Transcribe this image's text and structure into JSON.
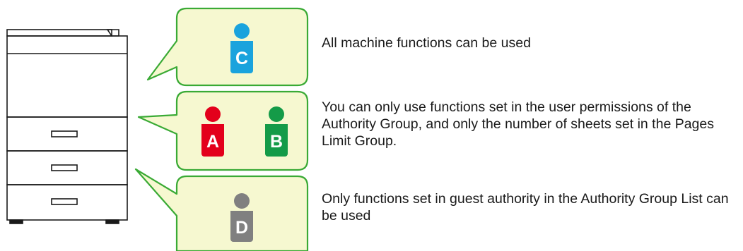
{
  "users": {
    "c": {
      "letter": "C",
      "color": "#1aa3dd"
    },
    "a": {
      "letter": "A",
      "color": "#e3001b"
    },
    "b": {
      "letter": "B",
      "color": "#149b48"
    },
    "d": {
      "letter": "D",
      "color": "#808080"
    }
  },
  "descriptions": {
    "c": "All machine functions can be used",
    "ab": "You can only use functions set in the user permissions of the Authority Group, and only the number of sheets set in the Pages Limit Group.",
    "d": "Only functions set in guest authority in the Authority Group List can be used"
  },
  "colors": {
    "bubble_fill": "#f6f8d0",
    "bubble_stroke": "#3aaa35",
    "printer_stroke": "#1a1a1a"
  }
}
